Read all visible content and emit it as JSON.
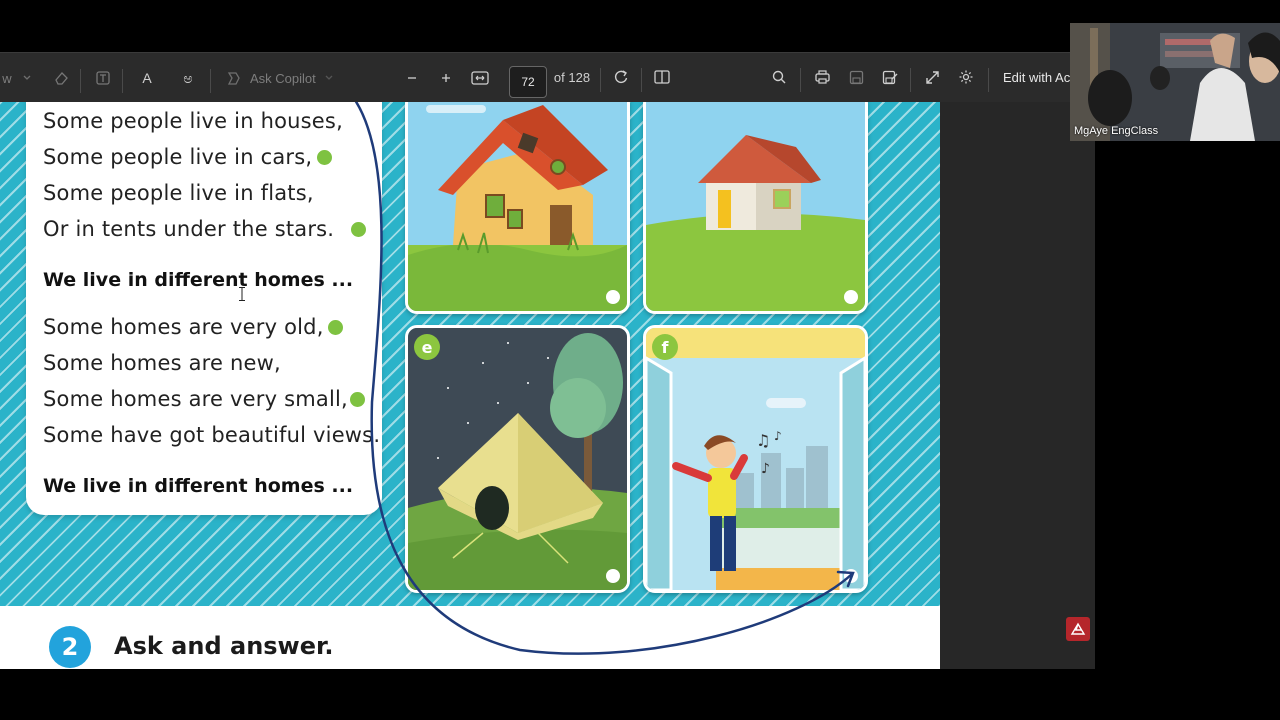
{
  "toolbar": {
    "view_partial": "w",
    "read_aloud": "A",
    "translate": "ಅ",
    "ask_copilot": "Ask Copilot",
    "page_number": "72",
    "page_total": "of 128",
    "edit_with": "Edit with Ac"
  },
  "poem": {
    "lines_1": [
      "Some people live in houses,",
      "Some people live in cars,",
      "Some people live in flats,",
      "Or in tents under the stars."
    ],
    "refrain_1": "We live in different homes ...",
    "lines_2": [
      "Some homes are very old,",
      "Some homes are new,",
      "Some homes are very small,",
      "Some have got beautiful views."
    ],
    "refrain_2": "We live in different homes ..."
  },
  "cards": {
    "e_label": "e",
    "f_label": "f"
  },
  "section": {
    "number": "2",
    "title": "Ask and answer."
  },
  "webcam": {
    "name": "MgAye EngClass"
  },
  "colors": {
    "stripe": "#2bb3c9",
    "badge_green": "#8cc63f",
    "section_blue": "#22a3dc",
    "annotation_navy": "#1f3b7a"
  },
  "icons": [
    "eraser-icon",
    "text-box-icon",
    "read-aloud-icon",
    "translate-icon",
    "copilot-icon",
    "zoom-out-icon",
    "zoom-in-icon",
    "fit-width-icon",
    "rotate-icon",
    "page-view-icon",
    "search-icon",
    "print-icon",
    "save-icon",
    "save-as-icon",
    "fullscreen-icon",
    "settings-icon",
    "adobe-pdf-icon"
  ]
}
